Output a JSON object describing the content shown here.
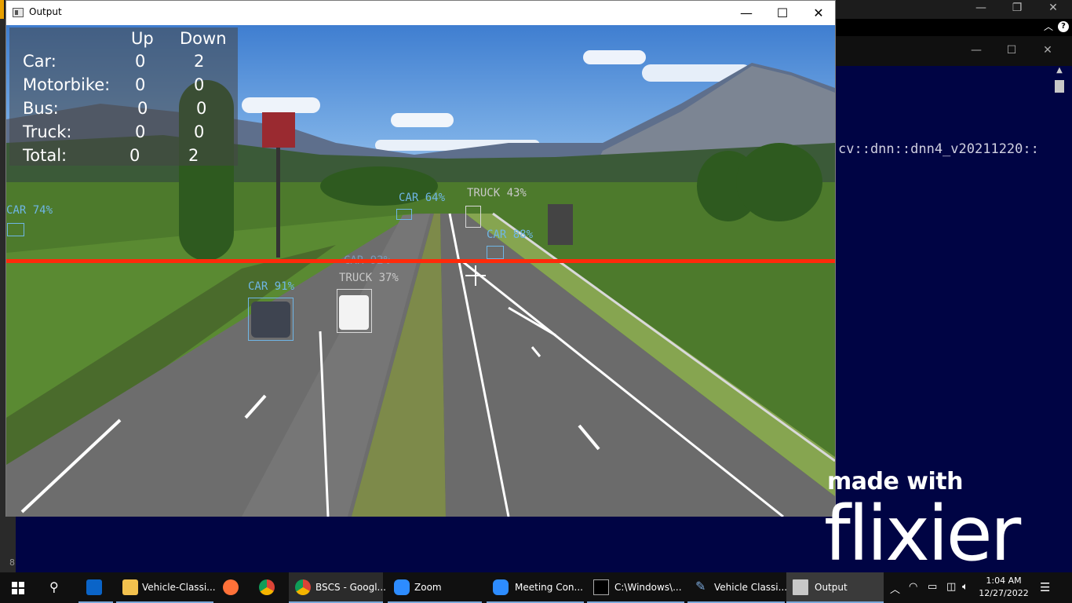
{
  "output_window": {
    "title": "Output",
    "minimize": "—",
    "maximize": "☐",
    "close": "✕"
  },
  "stats": {
    "header_up": "Up",
    "header_down": "Down",
    "rows": [
      {
        "label": "Car:",
        "up": "0",
        "down": "2"
      },
      {
        "label": "Motorbike:",
        "up": "0",
        "down": "0"
      },
      {
        "label": "Bus:",
        "up": "0",
        "down": "0"
      },
      {
        "label": "Truck:",
        "up": "0",
        "down": "0"
      },
      {
        "label": "Total:",
        "up": "0",
        "down": "2"
      }
    ]
  },
  "detections": [
    {
      "label": "CAR 74%"
    },
    {
      "label": "CAR 64%"
    },
    {
      "label": "TRUCK 43%"
    },
    {
      "label": "CAR 88%"
    },
    {
      "label": "CAR 92%"
    },
    {
      "label": "TRUCK 37%"
    },
    {
      "label": "CAR 91%"
    }
  ],
  "console": {
    "text": "cv::dnn::dnn4_v20211220::",
    "side_number": "8"
  },
  "watermark": {
    "line1": "made with",
    "line2": "flixier"
  },
  "taskbar": {
    "items": [
      {
        "label": "",
        "icon": "outlook-icon"
      },
      {
        "label": "Vehicle-Classi...",
        "icon": "folder-icon"
      },
      {
        "label": "",
        "icon": "firefox-icon"
      },
      {
        "label": "",
        "icon": "chrome-icon"
      },
      {
        "label": "BSCS - Googl...",
        "icon": "chrome-profile-icon"
      },
      {
        "label": "Zoom",
        "icon": "zoom-icon"
      },
      {
        "label": "Meeting Con...",
        "icon": "zoom-meeting-icon"
      },
      {
        "label": "C:\\Windows\\...",
        "icon": "cmd-icon"
      },
      {
        "label": "Vehicle Classi...",
        "icon": "python-idle-icon"
      },
      {
        "label": "Output",
        "icon": "output-window-icon"
      }
    ],
    "clock_time": "1:04 AM",
    "clock_date": "12/27/2022"
  },
  "colors": {
    "count_line": "#ff2a0a",
    "detection_box": "#6fb6e6",
    "console_bg": "#000444"
  }
}
